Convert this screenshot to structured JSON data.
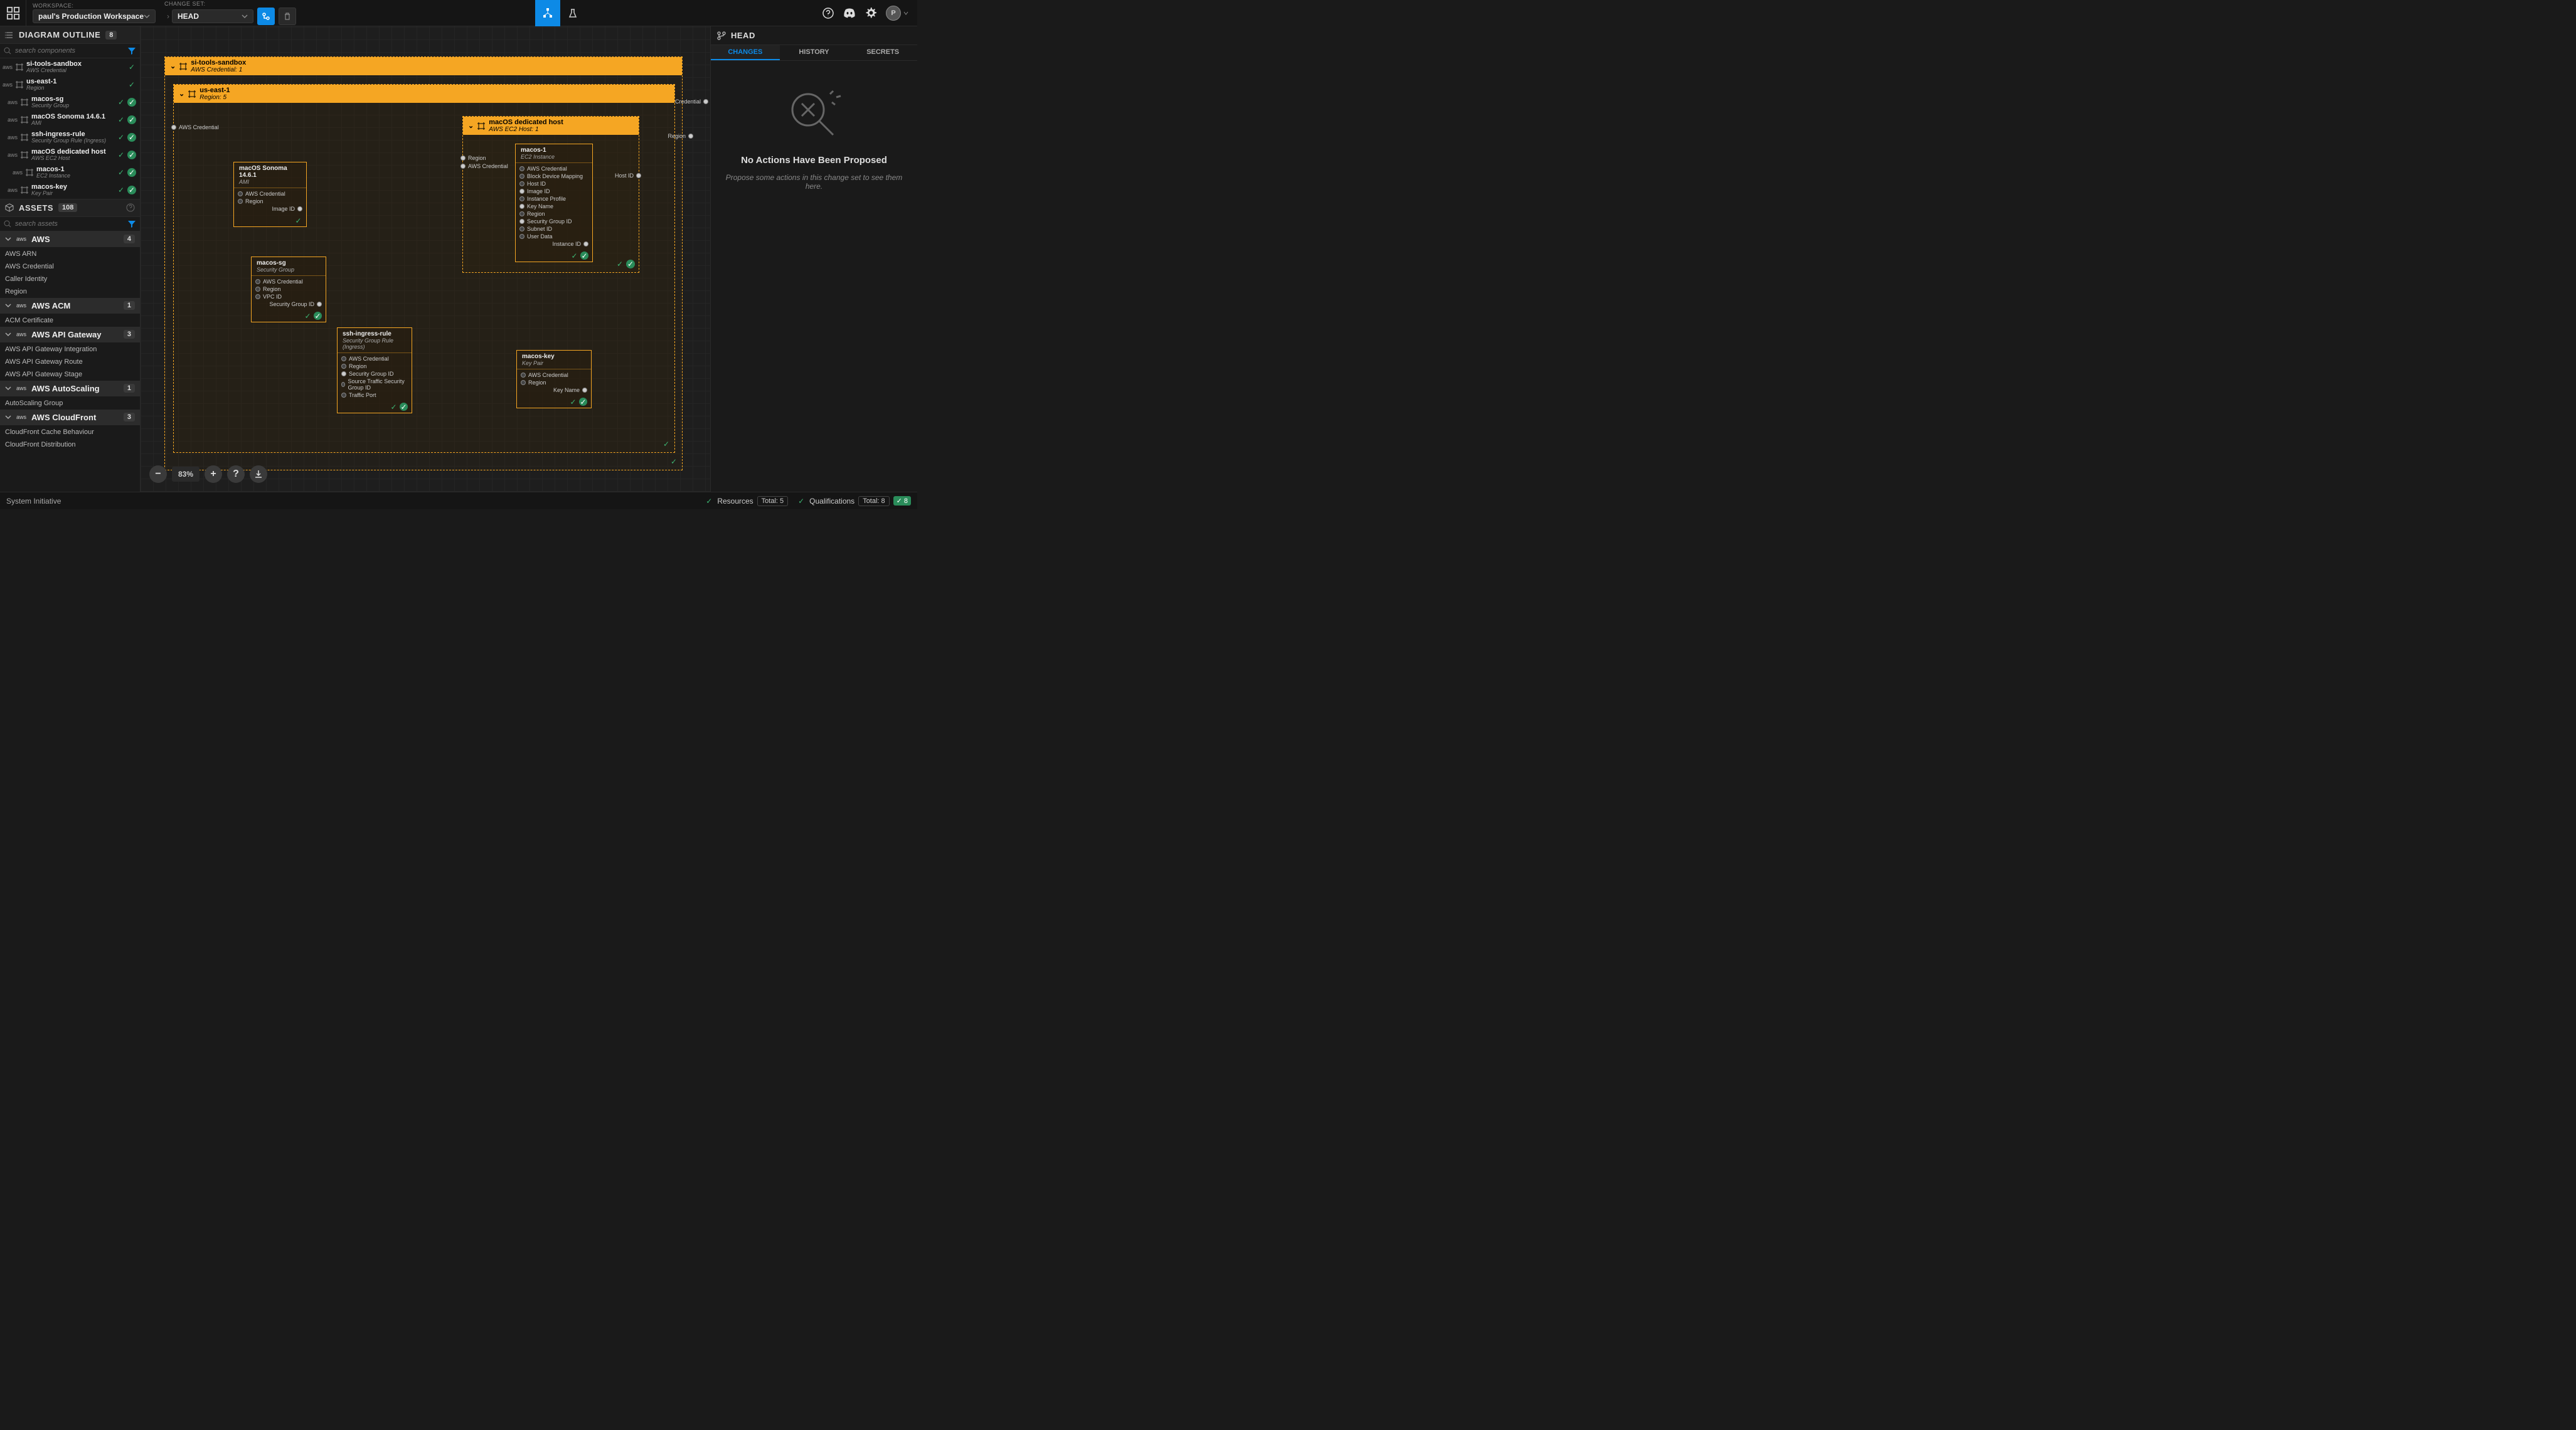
{
  "topbar": {
    "workspace_label": "WORKSPACE:",
    "workspace_value": "paul's Production Workspace",
    "changeset_label": "CHANGE SET:",
    "changeset_value": "HEAD",
    "user_initial": "P"
  },
  "outline": {
    "title": "DIAGRAM OUTLINE",
    "count": "8",
    "search_placeholder": "search components",
    "items": [
      {
        "name": "si-tools-sandbox",
        "sub": "AWS Credential",
        "level": 0,
        "statuses": 1
      },
      {
        "name": "us-east-1",
        "sub": "Region",
        "level": 0,
        "statuses": 1
      },
      {
        "name": "macos-sg",
        "sub": "Security Group",
        "level": 1,
        "statuses": 2
      },
      {
        "name": "macOS Sonoma 14.6.1",
        "sub": "AMI",
        "level": 1,
        "statuses": 2
      },
      {
        "name": "ssh-ingress-rule",
        "sub": "Security Group Rule (Ingress)",
        "level": 1,
        "statuses": 2
      },
      {
        "name": "macOS dedicated host",
        "sub": "AWS EC2 Host",
        "level": 1,
        "statuses": 2
      },
      {
        "name": "macos-1",
        "sub": "EC2 Instance",
        "level": 2,
        "statuses": 2
      },
      {
        "name": "macos-key",
        "sub": "Key Pair",
        "level": 1,
        "statuses": 2
      }
    ]
  },
  "assets": {
    "title": "ASSETS",
    "count": "108",
    "search_placeholder": "search assets",
    "categories": [
      {
        "name": "AWS",
        "count": "4",
        "items": [
          "AWS ARN",
          "AWS Credential",
          "Caller Identity",
          "Region"
        ]
      },
      {
        "name": "AWS ACM",
        "count": "1",
        "items": [
          "ACM Certificate"
        ]
      },
      {
        "name": "AWS API Gateway",
        "count": "3",
        "items": [
          "AWS API Gateway Integration",
          "AWS API Gateway Route",
          "AWS API Gateway Stage"
        ]
      },
      {
        "name": "AWS AutoScaling",
        "count": "1",
        "items": [
          "AutoScaling Group"
        ]
      },
      {
        "name": "AWS CloudFront",
        "count": "3",
        "items": [
          "CloudFront Cache Behaviour",
          "CloudFront Distribution"
        ]
      }
    ]
  },
  "canvas": {
    "zoom": "83%",
    "frames": {
      "sandbox": {
        "name": "si-tools-sandbox",
        "sub": "AWS Credential: 1"
      },
      "region": {
        "name": "us-east-1",
        "sub": "Region: 5"
      },
      "host": {
        "name": "macOS dedicated host",
        "sub": "AWS EC2 Host: 1"
      }
    },
    "sockets": {
      "aws_credential": "AWS Credential",
      "credential_out": "Credential",
      "region": "Region",
      "region_out": "Region",
      "image_id": "Image ID",
      "vpc_id": "VPC ID",
      "sg_id": "Security Group ID",
      "src_sg_id": "Source Traffic Security Group ID",
      "traffic_port": "Traffic Port",
      "host_id": "Host ID",
      "key_name": "Key Name",
      "instance_id": "Instance ID",
      "block_dev": "Block Device Mapping",
      "instance_profile": "Instance Profile",
      "subnet_id": "Subnet ID",
      "user_data": "User Data"
    },
    "nodes": {
      "ami": {
        "name": "macOS Sonoma 14.6.1",
        "sub": "AMI"
      },
      "sg": {
        "name": "macos-sg",
        "sub": "Security Group"
      },
      "ingress": {
        "name": "ssh-ingress-rule",
        "sub": "Security Group Rule (Ingress)"
      },
      "key": {
        "name": "macos-key",
        "sub": "Key Pair"
      },
      "ec2": {
        "name": "macos-1",
        "sub": "EC2 Instance"
      }
    }
  },
  "right": {
    "head_title": "HEAD",
    "tabs": {
      "changes": "CHANGES",
      "history": "HISTORY",
      "secrets": "SECRETS"
    },
    "empty_title": "No Actions Have Been Proposed",
    "empty_sub": "Propose some actions in this change set to see them here."
  },
  "bottom": {
    "brand": "System Initiative",
    "resources": "Resources",
    "resources_total": "Total: 5",
    "qualifications": "Qualifications",
    "qual_total": "Total: 8",
    "qual_pass": "8"
  }
}
